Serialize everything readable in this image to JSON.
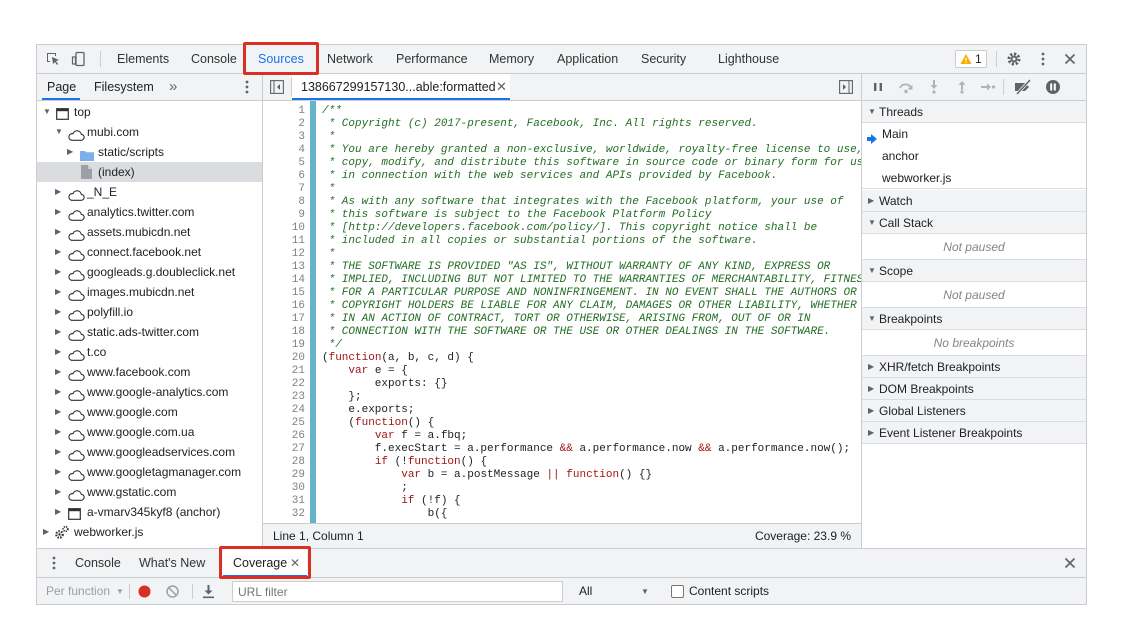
{
  "top_tabs": {
    "elements": "Elements",
    "console": "Console",
    "sources": "Sources",
    "network": "Network",
    "performance": "Performance",
    "memory": "Memory",
    "application": "Application",
    "security": "Security",
    "lighthouse": "Lighthouse"
  },
  "warnings": {
    "count": "1"
  },
  "nav": {
    "tab_page": "Page",
    "tab_filesystem": "Filesystem",
    "more": "»",
    "tree": [
      {
        "label": "top"
      },
      {
        "label": "mubi.com"
      },
      {
        "label": "static/scripts"
      },
      {
        "label": "(index)"
      },
      {
        "label": "_N_E"
      },
      {
        "label": "analytics.twitter.com"
      },
      {
        "label": "assets.mubicdn.net"
      },
      {
        "label": "connect.facebook.net"
      },
      {
        "label": "googleads.g.doubleclick.net"
      },
      {
        "label": "images.mubicdn.net"
      },
      {
        "label": "polyfill.io"
      },
      {
        "label": "static.ads-twitter.com"
      },
      {
        "label": "t.co"
      },
      {
        "label": "www.facebook.com"
      },
      {
        "label": "www.google-analytics.com"
      },
      {
        "label": "www.google.com"
      },
      {
        "label": "www.google.com.ua"
      },
      {
        "label": "www.googleadservices.com"
      },
      {
        "label": "www.googletagmanager.com"
      },
      {
        "label": "www.gstatic.com"
      },
      {
        "label": "a-vmarv345kyf8 (anchor)"
      },
      {
        "label": "webworker.js"
      }
    ]
  },
  "editor": {
    "file_tab": "138667299157130...able:formatted",
    "status_position": "Line 1, Column 1",
    "status_coverage": "Coverage: 23.9 %"
  },
  "debugger": {
    "threads": {
      "title": "Threads",
      "items": [
        "Main",
        "anchor",
        "webworker.js"
      ]
    },
    "watch": "Watch",
    "call_stack": "Call Stack",
    "call_stack_empty": "Not paused",
    "scope": "Scope",
    "scope_empty": "Not paused",
    "breakpoints": "Breakpoints",
    "breakpoints_empty": "No breakpoints",
    "xhr": "XHR/fetch Breakpoints",
    "dom": "DOM Breakpoints",
    "global": "Global Listeners",
    "event": "Event Listener Breakpoints"
  },
  "drawer": {
    "tab_console": "Console",
    "tab_whats_new": "What's New",
    "tab_coverage": "Coverage",
    "per_function": "Per function",
    "url_filter_placeholder": "URL filter",
    "type_filter": "All",
    "content_scripts": "Content scripts"
  },
  "code_lines": [
    "/**",
    " * Copyright (c) 2017-present, Facebook, Inc. All rights reserved.",
    " *",
    " * You are hereby granted a non-exclusive, worldwide, royalty-free license to use,",
    " * copy, modify, and distribute this software in source code or binary form for use",
    " * in connection with the web services and APIs provided by Facebook.",
    " *",
    " * As with any software that integrates with the Facebook platform, your use of",
    " * this software is subject to the Facebook Platform Policy",
    " * [http://developers.facebook.com/policy/]. This copyright notice shall be",
    " * included in all copies or substantial portions of the software.",
    " *",
    " * THE SOFTWARE IS PROVIDED \"AS IS\", WITHOUT WARRANTY OF ANY KIND, EXPRESS OR",
    " * IMPLIED, INCLUDING BUT NOT LIMITED TO THE WARRANTIES OF MERCHANTABILITY, FITNESS",
    " * FOR A PARTICULAR PURPOSE AND NONINFRINGEMENT. IN NO EVENT SHALL THE AUTHORS OR",
    " * COPYRIGHT HOLDERS BE LIABLE FOR ANY CLAIM, DAMAGES OR OTHER LIABILITY, WHETHER",
    " * IN AN ACTION OF CONTRACT, TORT OR OTHERWISE, ARISING FROM, OUT OF OR IN",
    " * CONNECTION WITH THE SOFTWARE OR THE USE OR OTHER DEALINGS IN THE SOFTWARE.",
    " */",
    "(function(a, b, c, d) {",
    "    var e = {",
    "        exports: {}",
    "    };",
    "    e.exports;",
    "    (function() {",
    "        var f = a.fbq;",
    "        f.execStart = a.performance && a.performance.now && a.performance.now();",
    "        if (!function() {",
    "            var b = a.postMessage || function() {}",
    "            ;",
    "            if (!f) {",
    "                b({"
  ],
  "colors": {
    "accent": "#1a73e8",
    "highlight": "#d93025",
    "comment": "#236e25",
    "coverage_bar": "#65b4c9"
  }
}
